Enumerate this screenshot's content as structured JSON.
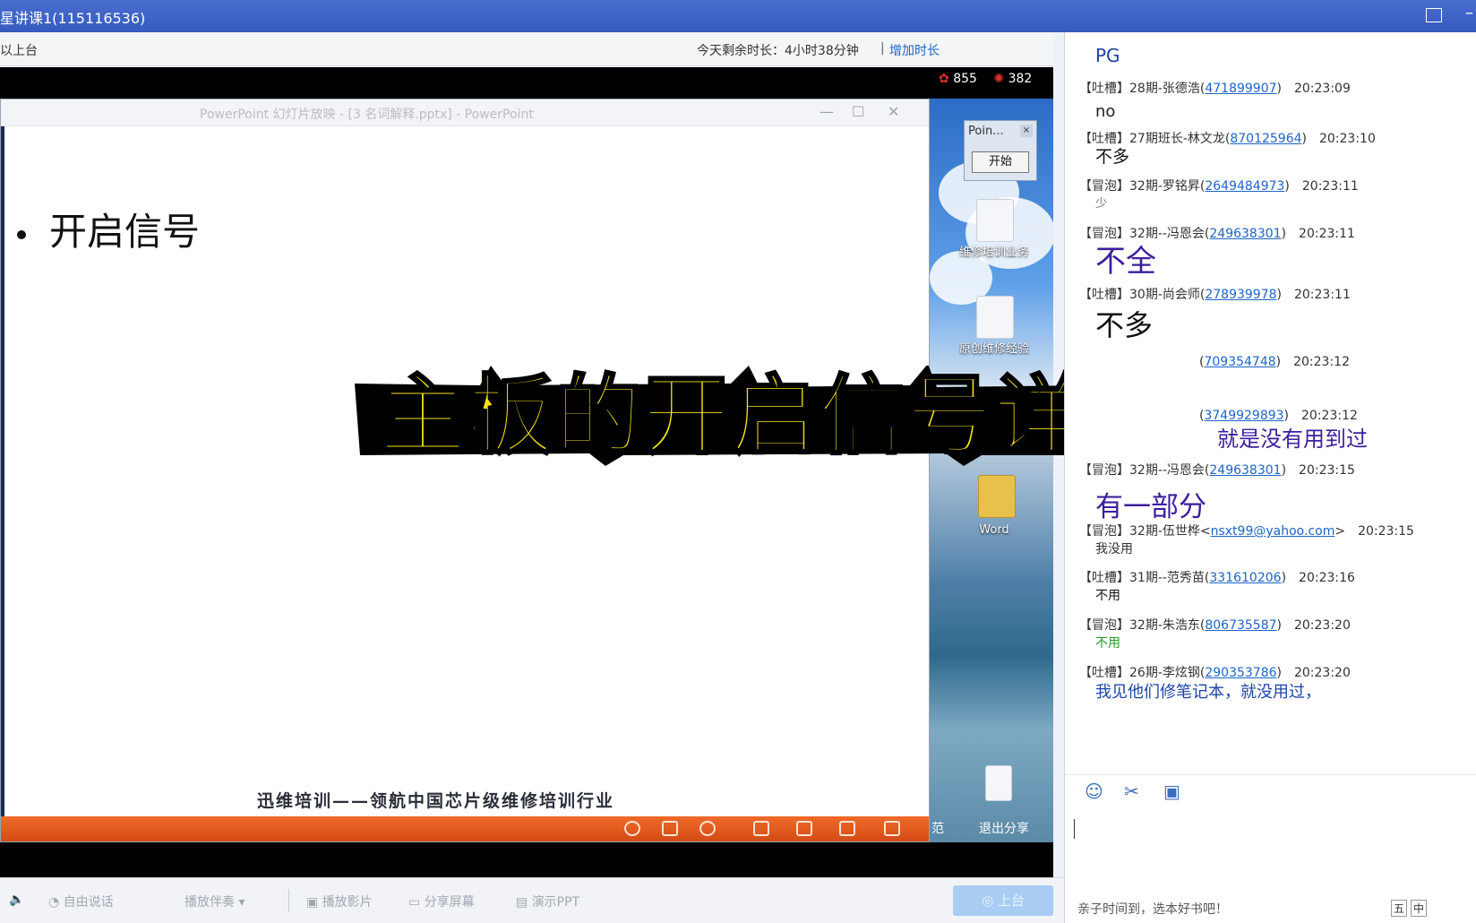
{
  "window": {
    "title": "星讲课1(115116536)"
  },
  "infobar": {
    "on_stage": "以上台",
    "remaining": "今天剩余时长：4小时38分钟",
    "separator": "|",
    "add_time": "增加时长"
  },
  "stage": {
    "flower_count": "855",
    "lollipop_count": "382"
  },
  "ppt": {
    "window_title": "PowerPoint 幻灯片放映 - [3 名词解释.pptx] - PowerPoint",
    "bullet": "开启信号",
    "footer": "迅维培训——领航中国芯片级维修培训行业"
  },
  "desktop": {
    "poin_title": "Poin...",
    "poin_close": "×",
    "poin_start": "开始",
    "icon1_label": "维修培训业务",
    "icon2_label": "原创维修经验",
    "icon3_label": "Word",
    "edge_left": "范",
    "exit_share": "退出分享"
  },
  "overlay": {
    "headline": "主板的开启信号详解"
  },
  "bottombar": {
    "free_talk": "自由说话",
    "play_accompany": "播放伴奏",
    "play_movie": "播放影片",
    "share_screen": "分享屏幕",
    "present_ppt": "演示PPT",
    "go_stage": "上台"
  },
  "chat": {
    "top_text": "PG",
    "messages": [
      {
        "tag": "【吐槽】",
        "name": "28期-张德浩",
        "qq": "471899907",
        "time": "20:23:09",
        "body": "no",
        "color": "#222222",
        "size": "18"
      },
      {
        "tag": "【吐槽】",
        "name": "27期班长-林文龙",
        "qq": "870125964",
        "time": "20:23:10",
        "body": "不多",
        "color": "#111111",
        "size": "19"
      },
      {
        "tag": "【冒泡】",
        "name": "32期-罗铭昇",
        "qq": "2649484973",
        "time": "20:23:11",
        "body": "少",
        "color": "#777777",
        "size": "13"
      },
      {
        "tag": "【冒泡】",
        "name": "32期--冯恩会",
        "qq": "249638301",
        "time": "20:23:11",
        "body": "不全",
        "color": "#3d1e9e",
        "size": "34"
      },
      {
        "tag": "【吐槽】",
        "name": "30期-尚会师",
        "qq": "278939978",
        "time": "20:23:11",
        "body": "不多",
        "color": "#111111",
        "size": "32"
      },
      {
        "tag": "",
        "name": "",
        "qq": "709354748",
        "time": "20:23:12",
        "body": "",
        "color": "#111111",
        "size": "14"
      },
      {
        "tag": "",
        "name": "",
        "qq": "3749929893",
        "time": "20:23:12",
        "body": "就是没有用到过",
        "color": "#3d1e9e",
        "size": "24"
      },
      {
        "tag": "【冒泡】",
        "name": "32期--冯恩会",
        "qq": "249638301",
        "time": "20:23:15",
        "body": "有一部分",
        "color": "#3d1e9e",
        "size": "31"
      },
      {
        "tag": "【冒泡】",
        "name": "32期-伍世桦",
        "qq": "nsxt99@yahoo.com",
        "time": "20:23:15",
        "body": "我没用",
        "color": "#333333",
        "size": "14"
      },
      {
        "tag": "【吐槽】",
        "name": "31期--范秀苗",
        "qq": "331610206",
        "time": "20:23:16",
        "body": "不用",
        "color": "#111111",
        "size": "14"
      },
      {
        "tag": "【冒泡】",
        "name": "32期-朱浩东",
        "qq": "806735587",
        "time": "20:23:20",
        "body": "不用",
        "color": "#2a9a2a",
        "size": "14"
      },
      {
        "tag": "【吐槽】",
        "name": "26期-李炫钢",
        "qq": "290353786",
        "time": "20:23:20",
        "body": "我见他们修笔记本，就没用过，",
        "color": "#1d44a8",
        "size": "18"
      }
    ],
    "ad_text": "亲子时间到，选本好书吧！",
    "ime_text": "中"
  },
  "colors": {
    "titlebar": "#3559bd",
    "headline_fill": "#f5e418",
    "ppt_toolbar": "#e35a1c",
    "link": "#1d64c8"
  }
}
